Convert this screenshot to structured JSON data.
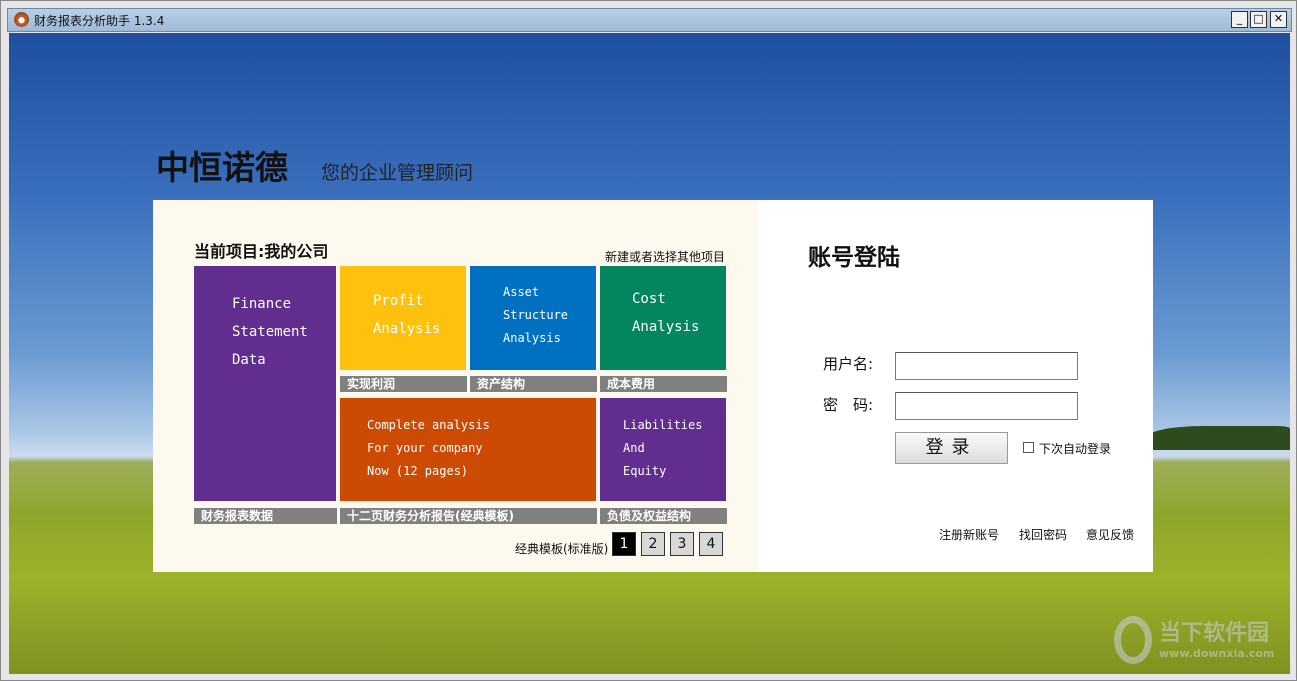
{
  "window": {
    "title": "财务报表分析助手 1.3.4",
    "min": "_",
    "max": "□",
    "close": "✕"
  },
  "header": {
    "brand": "中恒诺德",
    "slogan": "您的企业管理顾问"
  },
  "project": {
    "current": "当前项目:我的公司",
    "other_link": "新建或者选择其他项目"
  },
  "tiles": [
    {
      "lines": [
        "Finance",
        "Statement",
        "Data"
      ],
      "label": "财务报表数据",
      "color": "#612d8e"
    },
    {
      "lines": [
        "Profit",
        "Analysis"
      ],
      "label": "实现利润",
      "color": "#fec20e"
    },
    {
      "lines": [
        "Asset",
        "Structure",
        "Analysis"
      ],
      "label": "资产结构",
      "color": "#0070c0"
    },
    {
      "lines": [
        "Cost",
        "Analysis"
      ],
      "label": "成本费用",
      "color": "#038560"
    },
    {
      "lines": [
        "Complete analysis",
        "For your company",
        "Now (12 pages)"
      ],
      "label": "十二页财务分析报告(经典模板)",
      "color": "#cc4a02"
    },
    {
      "lines": [
        "Liabilities",
        "And",
        "Equity"
      ],
      "label": "负债及权益结构",
      "color": "#612d8e"
    }
  ],
  "template": {
    "label": "经典模板(标准版)",
    "pages": [
      "1",
      "2",
      "3",
      "4"
    ],
    "current": "1"
  },
  "login": {
    "title": "账号登陆",
    "username_label": "用户名:",
    "username": "",
    "password_label": "密　码:",
    "password": "",
    "submit": "登录",
    "auto_login": "下次自动登录",
    "auto_login_checked": false,
    "links": [
      "注册新账号",
      "找回密码",
      "意见反馈"
    ]
  },
  "watermark": {
    "name": "当下软件园",
    "url": "www.downxia.com"
  }
}
